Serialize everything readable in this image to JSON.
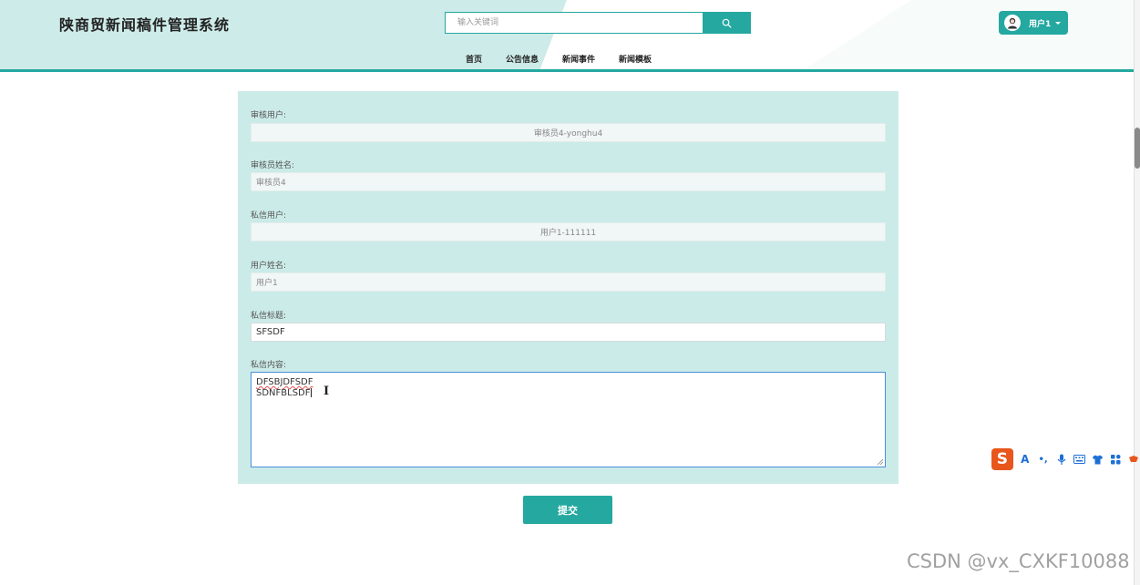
{
  "header": {
    "site_title": "陕商贸新闻稿件管理系统",
    "search_placeholder": "输入关键词",
    "user_label": "用户1"
  },
  "nav": {
    "items": [
      "首页",
      "公告信息",
      "新闻事件",
      "新闻模板"
    ]
  },
  "form": {
    "fields": [
      {
        "label": "审核用户:",
        "value": "审核员4-yonghu4"
      },
      {
        "label": "审核员姓名:",
        "value": "审核员4"
      },
      {
        "label": "私信用户:",
        "value": "用户1-111111"
      },
      {
        "label": "用户姓名:",
        "value": "用户1"
      },
      {
        "label": "私信标题:",
        "value": "SFSDF"
      }
    ],
    "content_label": "私信内容:",
    "content_lines": [
      "DFSBJDFSDF",
      "SDNFBLSDF"
    ],
    "submit_label": "提交"
  },
  "ime": {
    "logo": "S",
    "items": [
      "A",
      "•,",
      "mic-icon",
      "keyboard-icon",
      "shirt-icon",
      "grid-icon",
      "tools-icon"
    ]
  },
  "watermark": "CSDN @vx_CXKF10088",
  "colors": {
    "accent": "#24a8a0",
    "panel": "#cbebe8",
    "header_light": "#cdebe8"
  }
}
